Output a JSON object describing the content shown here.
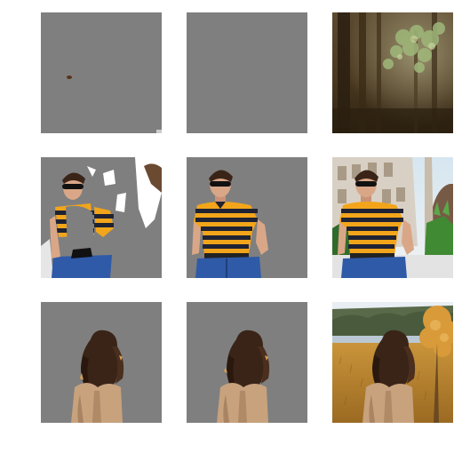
{
  "colors": {
    "page_background": "#ffffff",
    "mask_gray": "#7f7f7f",
    "shirt_yellow": "#f2a51a",
    "shirt_navy": "#1f2333",
    "jeans_blue": "#2f5aa8",
    "hair_brown": "#3a2418",
    "jacket_tan": "#c7a27d",
    "forest_dark": "#3a2c1a",
    "forest_leaf": "#9fb87a",
    "autumn_orange": "#d99a3a",
    "sky_pale": "#e8eef3"
  },
  "grid": {
    "rows": [
      {
        "subject": "forest",
        "tiles": [
          {
            "kind": "masked-partial",
            "icon": "forest-speck-icon"
          },
          {
            "kind": "masked-empty",
            "icon": "blank-gray-icon"
          },
          {
            "kind": "original-photo",
            "icon": "forest-photo-icon"
          }
        ]
      },
      {
        "subject": "man-striped-shirt",
        "tiles": [
          {
            "kind": "masked-partial",
            "icon": "man-partial-cutout-icon"
          },
          {
            "kind": "masked-cutout",
            "icon": "man-cutout-icon"
          },
          {
            "kind": "original-photo",
            "icon": "man-photo-icon"
          }
        ]
      },
      {
        "subject": "woman-long-hair",
        "tiles": [
          {
            "kind": "masked-cutout",
            "icon": "woman-cutout-icon"
          },
          {
            "kind": "masked-cutout",
            "icon": "woman-cutout-icon"
          },
          {
            "kind": "original-photo",
            "icon": "autumn-field-photo-icon"
          }
        ]
      }
    ]
  }
}
